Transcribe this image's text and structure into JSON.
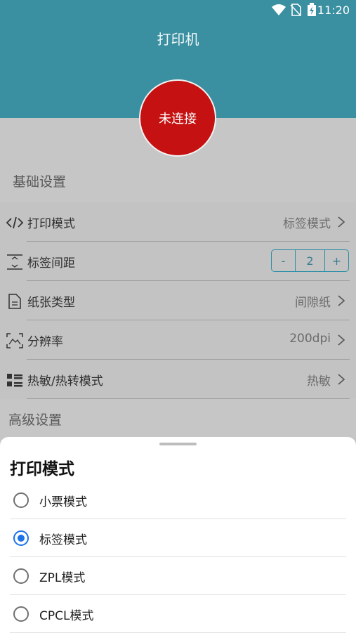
{
  "status_bar": {
    "time": "11:20",
    "icons": [
      "wifi-icon",
      "no-sim-icon",
      "battery-charging-icon"
    ]
  },
  "header": {
    "title": "打印机"
  },
  "connect": {
    "label": "未连接",
    "color": "#c51111"
  },
  "sections": {
    "basic": "基础设置",
    "advanced": "高级设置"
  },
  "rows": [
    {
      "icon": "code-icon",
      "label": "打印模式",
      "value": "标签模式"
    },
    {
      "icon": "label-spacing-icon",
      "label": "标签间距",
      "stepper": {
        "minus": "-",
        "value": "2",
        "plus": "+"
      }
    },
    {
      "icon": "document-icon",
      "label": "纸张类型",
      "value": "间隙纸"
    },
    {
      "icon": "resolution-icon",
      "label": "分辨率",
      "value": "200dpi"
    },
    {
      "icon": "list-icon",
      "label": "热敏/热转模式",
      "value": "热敏"
    }
  ],
  "sheet": {
    "title": "打印模式",
    "options": [
      {
        "label": "小票模式",
        "selected": false
      },
      {
        "label": "标签模式",
        "selected": true
      },
      {
        "label": "ZPL模式",
        "selected": false
      },
      {
        "label": "CPCL模式",
        "selected": false
      }
    ],
    "accent": "#1a73e8"
  }
}
